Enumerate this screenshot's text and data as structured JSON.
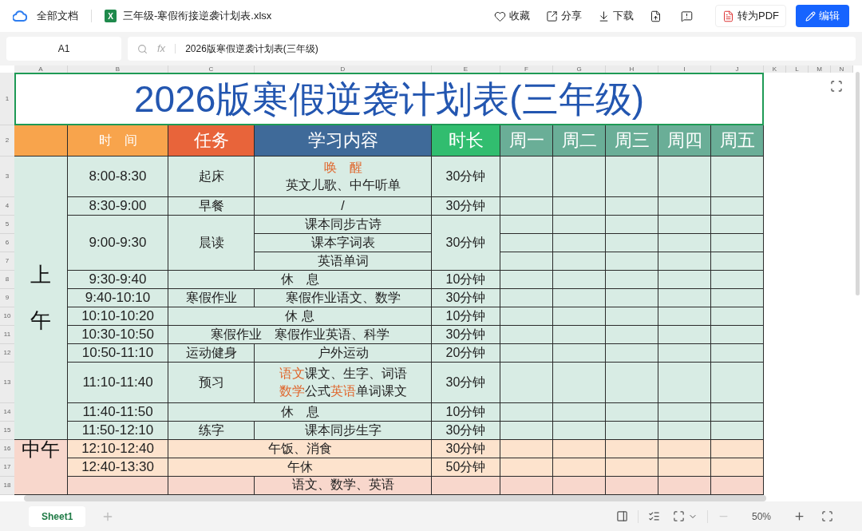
{
  "topbar": {
    "home": "全部文档",
    "file_badge": "X",
    "file_name": "三年级-寒假衔接逆袭计划表.xlsx",
    "actions": [
      "收藏",
      "分享",
      "下载"
    ],
    "pdf_button": "转为PDF",
    "edit_button": "编辑"
  },
  "formula_bar": {
    "cell_ref": "A1",
    "fx": "fx",
    "value": "2026版寒假逆袭计划表(三年级)"
  },
  "column_letters": [
    "A",
    "B",
    "C",
    "D",
    "E",
    "F",
    "G",
    "H",
    "I",
    "J",
    "K",
    "L",
    "M",
    "N"
  ],
  "row_numbers": [
    "1",
    "2",
    "3",
    "4",
    "5",
    "6",
    "7",
    "8",
    "9",
    "10",
    "11",
    "12",
    "13",
    "14",
    "15",
    "16",
    "17",
    "18"
  ],
  "title": "2026版寒假逆袭计划表(三年级)",
  "headers": [
    {
      "kind": "corner",
      "color": "#f8a44c"
    },
    {
      "kind": "column",
      "text": "时　间",
      "color": "#f8a44c"
    },
    {
      "kind": "column",
      "text": "任务",
      "color": "#e8643a"
    },
    {
      "kind": "column",
      "text": "学习内容",
      "color": "#3f6a99"
    },
    {
      "kind": "column",
      "text": "时长",
      "color": "#31bd6f"
    },
    {
      "kind": "day",
      "text": "周一",
      "color": "#6aae97"
    },
    {
      "kind": "day",
      "text": "周二",
      "color": "#6aae97"
    },
    {
      "kind": "day",
      "text": "周三",
      "color": "#6aae97"
    },
    {
      "kind": "day",
      "text": "周四",
      "color": "#6aae97"
    },
    {
      "kind": "day",
      "text": "周五",
      "color": "#6aae97"
    }
  ],
  "periods": [
    {
      "label": "上午",
      "kind": "vertical",
      "color": "#d8ece4",
      "rows": [
        {
          "kind": "task",
          "time": "8:00-8:30",
          "task": "起床",
          "content_lines": [
            [
              {
                "text": "唤　醒",
                "accent": true
              }
            ],
            [
              {
                "text": "英文儿歌、中午听单",
                "accent": false
              }
            ]
          ],
          "duration": "30分钟"
        },
        {
          "kind": "task",
          "time": "8:30-9:00",
          "task": "早餐",
          "content": "/",
          "duration": "30分钟"
        },
        {
          "kind": "stacked",
          "time": "9:00-9:30",
          "task": "晨读",
          "subrows": [
            "课本同步古诗",
            "课本字词表",
            "英语单词"
          ],
          "duration": "30分钟"
        },
        {
          "kind": "merged",
          "time": "9:30-9:40",
          "content": "休　息",
          "duration": "10分钟"
        },
        {
          "kind": "task",
          "time": "9:40-10:10",
          "task": "寒假作业",
          "content": "寒假作业语文、数学",
          "duration": "30分钟"
        },
        {
          "kind": "merged",
          "time": "10:10-10:20",
          "content": "休 息",
          "duration": "10分钟"
        },
        {
          "kind": "merged",
          "time": "10:30-10:50",
          "content": "寒假作业　寒假作业英语、科学",
          "duration": "30分钟"
        },
        {
          "kind": "task",
          "time": "10:50-11:10",
          "task": "运动健身",
          "content": "户外运动",
          "duration": "20分钟"
        },
        {
          "kind": "task",
          "time": "11:10-11:40",
          "task": "预习",
          "content_lines": [
            [
              {
                "text": "语文",
                "accent": true
              },
              {
                "text": "课文、生字、词语",
                "accent": false
              }
            ],
            [
              {
                "text": "数学",
                "accent": true
              },
              {
                "text": "公式",
                "accent": false
              },
              {
                "text": "英语",
                "accent": true
              },
              {
                "text": "单词课文",
                "accent": false
              }
            ]
          ],
          "duration": "30分钟"
        },
        {
          "kind": "merged",
          "time": "11:40-11:50",
          "content": "休　息",
          "duration": "10分钟"
        },
        {
          "kind": "task",
          "time": "11:50-12:10",
          "task": "练字",
          "content": "课本同步生字",
          "duration": "30分钟"
        }
      ]
    },
    {
      "label": "中午",
      "kind": "horizontal",
      "color": "#f8d7cc",
      "rows": [
        {
          "kind": "merged",
          "time": "12:10-12:40",
          "content": "午饭、消食",
          "duration": "30分钟",
          "color": "#fde3cd"
        },
        {
          "kind": "merged",
          "time": "12:40-13:30",
          "content": "午休",
          "duration": "50分钟",
          "color": "#fde3cd"
        },
        {
          "kind": "task",
          "content": "语文、数学、英语",
          "color": "#f8d7cc"
        }
      ]
    }
  ],
  "sheet_tabs": [
    {
      "label": "Sheet1",
      "selected": true
    }
  ],
  "zoom": "50%"
}
